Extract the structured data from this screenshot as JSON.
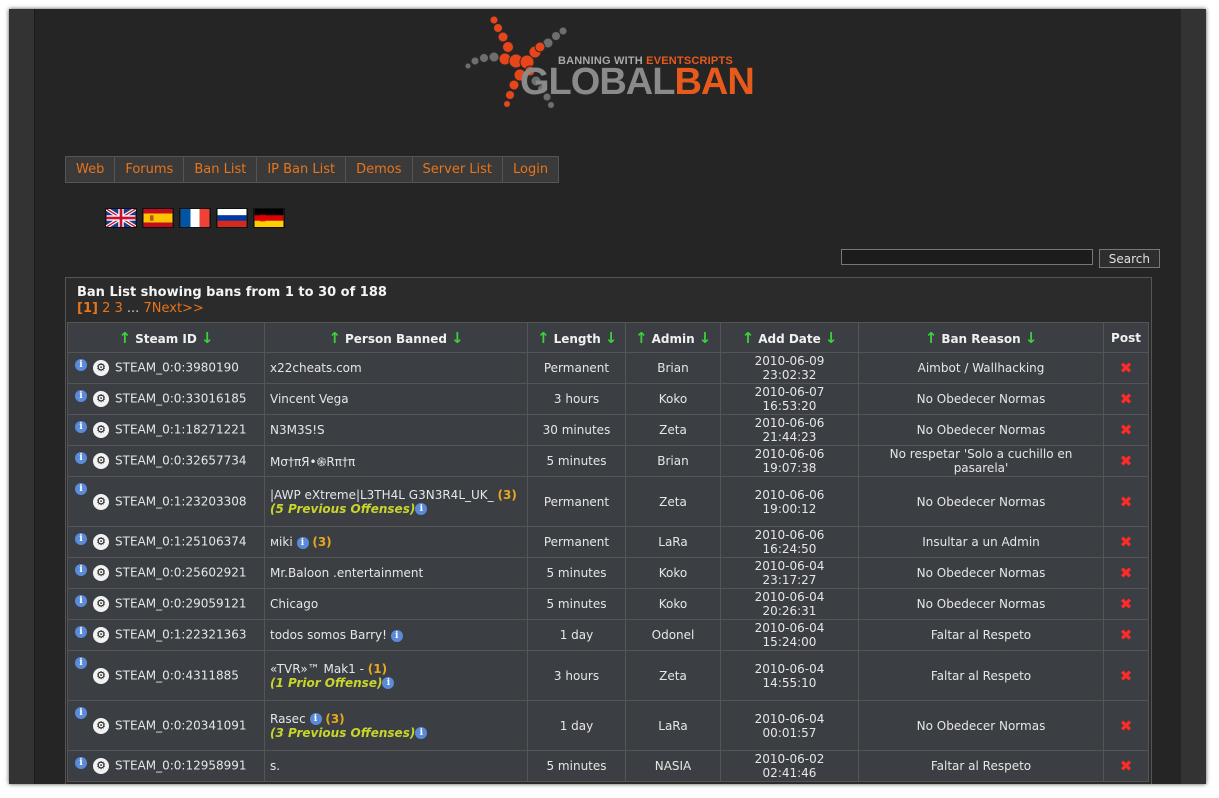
{
  "logo": {
    "small_pre": "BANNING WITH ",
    "small_accent": "EVENTSCRIPTS",
    "big_gray": "GLOBAL",
    "big_accent": "BAN"
  },
  "nav": [
    "Web",
    "Forums",
    "Ban List",
    "IP Ban List",
    "Demos",
    "Server List",
    "Login"
  ],
  "flags": [
    "flag-uk-icon",
    "flag-spain-icon",
    "flag-france-icon",
    "flag-russia-icon",
    "flag-germany-icon"
  ],
  "search": {
    "placeholder": "",
    "button": "Search"
  },
  "panel": {
    "title": "Ban List showing bans from 1 to 30 of 188",
    "pager": {
      "current": "[1]",
      "pages": [
        "2",
        "3"
      ],
      "ellipsis": "...",
      "last": "7",
      "next": "Next>>"
    }
  },
  "columns": [
    "Steam ID",
    "Person Banned",
    "Length",
    "Admin",
    "Add Date",
    "Ban Reason",
    "Post"
  ],
  "rows": [
    {
      "id": "STEAM_0:0:3980190",
      "name": "x22cheats.com",
      "length": "Permanent",
      "admin": "Brian",
      "date": "2010-06-09 23:02:32",
      "reason": "Aimbot / Wallhacking"
    },
    {
      "id": "STEAM_0:0:33016185",
      "name": "Vincent Vega",
      "length": "3 hours",
      "admin": "Koko",
      "date": "2010-06-07 16:53:20",
      "reason": "No Obedecer Normas"
    },
    {
      "id": "STEAM_0:1:18271221",
      "name": "N3M3S!S",
      "length": "30 minutes",
      "admin": "Zeta",
      "date": "2010-06-06 21:44:23",
      "reason": "No Obedecer Normas"
    },
    {
      "id": "STEAM_0:0:32657734",
      "name": "Mσ†πЯ•֍Rπ†π",
      "length": "5 minutes",
      "admin": "Brian",
      "date": "2010-06-06 19:07:38",
      "reason": "No respetar 'Solo a cuchillo en pasarela'"
    },
    {
      "id": "STEAM_0:1:23203308",
      "name": "|AWP eXtreme|L3TH4L G3N3R4L_UK_",
      "count": "(3)",
      "prior": "(5 Previous Offenses)",
      "length": "Permanent",
      "admin": "Zeta",
      "date": "2010-06-06 19:00:12",
      "reason": "No Obedecer Normas"
    },
    {
      "id": "STEAM_0:1:25106374",
      "name": "мikі",
      "name_info": true,
      "count": "(3)",
      "length": "Permanent",
      "admin": "LaRa",
      "date": "2010-06-06 16:24:50",
      "reason": "Insultar a un Admin"
    },
    {
      "id": "STEAM_0:0:25602921",
      "name": "Mr.Baloon .entertainment",
      "length": "5 minutes",
      "admin": "Koko",
      "date": "2010-06-04 23:17:27",
      "reason": "No Obedecer Normas"
    },
    {
      "id": "STEAM_0:0:29059121",
      "name": "Chicago",
      "length": "5 minutes",
      "admin": "Koko",
      "date": "2010-06-04 20:26:31",
      "reason": "No Obedecer Normas"
    },
    {
      "id": "STEAM_0:1:22321363",
      "name": "todos somos Barry!",
      "name_info": true,
      "length": "1 day",
      "admin": "Odonel",
      "date": "2010-06-04 15:24:00",
      "reason": "Faltar al Respeto"
    },
    {
      "id": "STEAM_0:0:4311885",
      "name": "«TVR»™ Mak1 -",
      "count": "(1)",
      "prior": "(1 Prior Offense)",
      "length": "3 hours",
      "admin": "Zeta",
      "date": "2010-06-04 14:55:10",
      "reason": "Faltar al Respeto"
    },
    {
      "id": "STEAM_0:0:20341091",
      "name": "Rasec",
      "name_info": true,
      "count": "(3)",
      "prior": "(3 Previous Offenses)",
      "length": "1 day",
      "admin": "LaRa",
      "date": "2010-06-04 00:01:57",
      "reason": "No Obedecer Normas"
    },
    {
      "id": "STEAM_0:0:12958991",
      "name": "s.",
      "length": "5 minutes",
      "admin": "NASIA",
      "date": "2010-06-02 02:41:46",
      "reason": "Faltar al Respeto"
    }
  ],
  "icons": {
    "info": "i",
    "steam": "⚙",
    "delete": "✖",
    "sort": "↑"
  },
  "colors": {
    "accent": "#e8741b",
    "sort_arrow": "#3cd13c",
    "delete": "#ff2a2a",
    "offense": "#c9d52a"
  }
}
